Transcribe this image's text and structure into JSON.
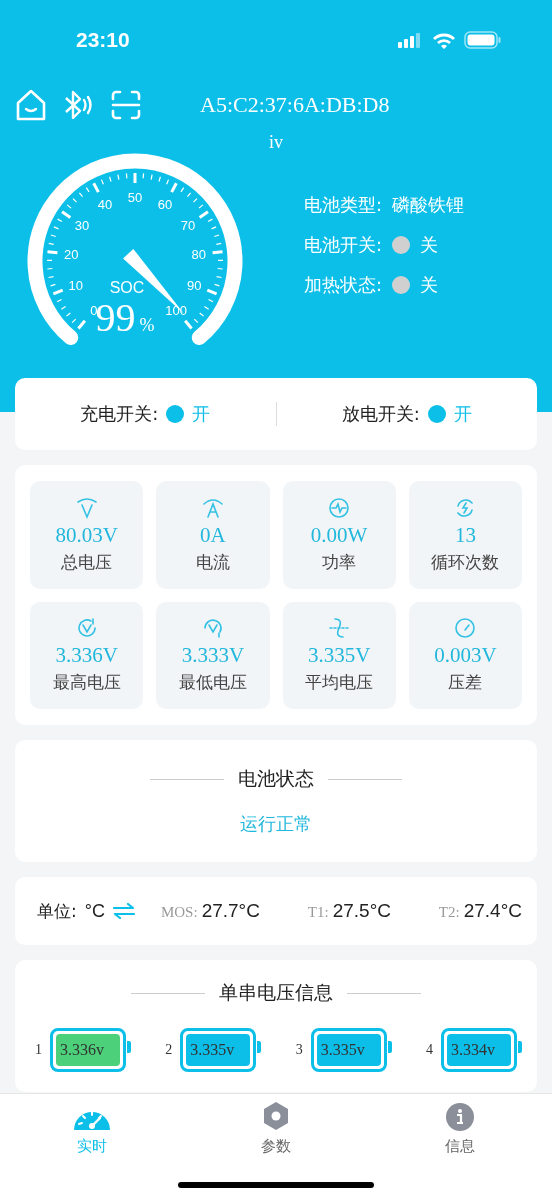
{
  "status_bar": {
    "time": "23:10"
  },
  "toolbar": {
    "device": "A5:C2:37:6A:DB:D8",
    "subtitle": "iv"
  },
  "gauge": {
    "label": "SOC",
    "value": "99",
    "unit": "%",
    "scale": [
      "50",
      "40",
      "60",
      "30",
      "70",
      "20",
      "80",
      "10",
      "90",
      "0",
      "100"
    ]
  },
  "battery_info": [
    {
      "kind": "text",
      "label": "电池类型:",
      "value": "磷酸铁锂"
    },
    {
      "kind": "switch",
      "label": "电池开关:",
      "value": "关",
      "on": false
    },
    {
      "kind": "switch",
      "label": "加热状态:",
      "value": "关",
      "on": false
    }
  ],
  "switches": [
    {
      "label": "充电开关:",
      "value": "开",
      "on": true
    },
    {
      "label": "放电开关:",
      "value": "开",
      "on": true
    }
  ],
  "metrics": [
    {
      "value": "80.03V",
      "label": "总电压"
    },
    {
      "value": "0A",
      "label": "电流"
    },
    {
      "value": "0.00W",
      "label": "功率"
    },
    {
      "value": "13",
      "label": "循环次数"
    },
    {
      "value": "3.336V",
      "label": "最高电压"
    },
    {
      "value": "3.333V",
      "label": "最低电压"
    },
    {
      "value": "3.335V",
      "label": "平均电压"
    },
    {
      "value": "0.003V",
      "label": "压差"
    }
  ],
  "battery_status": {
    "title": "电池状态",
    "value": "运行正常"
  },
  "temperature": {
    "unit_label": "单位:",
    "unit": "°C",
    "sensors": [
      {
        "label": "MOS:",
        "value": "27.7°C"
      },
      {
        "label": "T1:",
        "value": "27.5°C"
      },
      {
        "label": "T2:",
        "value": "27.4°C"
      }
    ]
  },
  "cells": {
    "title": "单串电压信息",
    "items": [
      {
        "index": "1",
        "voltage": "3.336v",
        "color": "#4cd07a"
      },
      {
        "index": "2",
        "voltage": "3.335v",
        "color": "#0cbfe8"
      },
      {
        "index": "3",
        "voltage": "3.335v",
        "color": "#0cbfe8"
      },
      {
        "index": "4",
        "voltage": "3.334v",
        "color": "#0cbfe8"
      }
    ]
  },
  "tab_bar": [
    {
      "label": "实时",
      "selected": true
    },
    {
      "label": "参数",
      "selected": false
    },
    {
      "label": "信息",
      "selected": false
    }
  ]
}
